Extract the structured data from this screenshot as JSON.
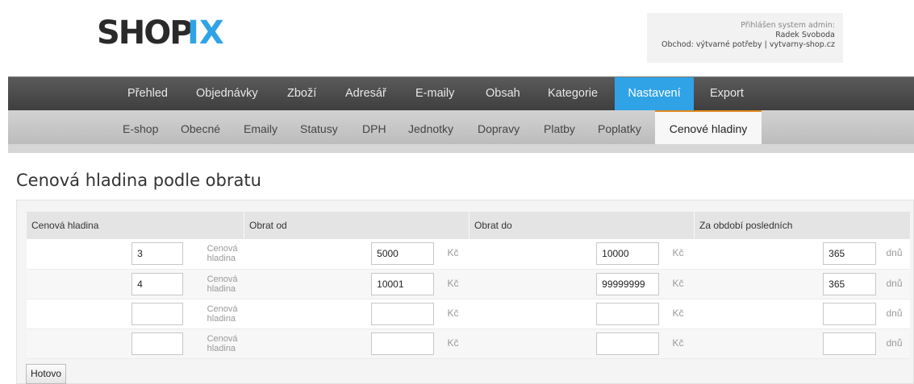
{
  "brand": {
    "logo_text": "SHOPIX",
    "accent_color": "#2fa3e6",
    "logo_color": "#2a2a2a",
    "logo_dot_color": "#2fa3e6"
  },
  "user": {
    "logged_in_label": "Přihlášen system admin:",
    "name": "Radek Svoboda",
    "shop_line": "Obchod: výtvarné potřeby | vytvarny-shop.cz"
  },
  "main_nav": {
    "items": [
      {
        "label": "Přehled"
      },
      {
        "label": "Objednávky"
      },
      {
        "label": "Zboží"
      },
      {
        "label": "Adresář"
      },
      {
        "label": "E-maily"
      },
      {
        "label": "Obsah"
      },
      {
        "label": "Kategorie"
      },
      {
        "label": "Nastavení",
        "active": true
      },
      {
        "label": "Export"
      }
    ]
  },
  "sub_nav": {
    "items": [
      {
        "label": "E-shop"
      },
      {
        "label": "Obecné"
      },
      {
        "label": "Emaily"
      },
      {
        "label": "Statusy"
      },
      {
        "label": "DPH"
      },
      {
        "label": "Jednotky"
      },
      {
        "label": "Dopravy"
      },
      {
        "label": "Platby"
      },
      {
        "label": "Poplatky"
      },
      {
        "label": "Cenové hladiny",
        "active": true
      }
    ]
  },
  "page": {
    "title": "Cenová hladina podle obratu"
  },
  "table": {
    "columns": [
      "Cenová hladina",
      "Obrat od",
      "Obrat do",
      "Za období posledních"
    ],
    "unit_level_line1": "Cenová",
    "unit_level_line2": "hladina",
    "unit_currency": "Kč",
    "unit_days": "dnů",
    "rows": [
      {
        "level": "3",
        "from": "5000",
        "to": "10000",
        "days": "365"
      },
      {
        "level": "4",
        "from": "10001",
        "to": "99999999",
        "days": "365"
      },
      {
        "level": "",
        "from": "",
        "to": "",
        "days": ""
      },
      {
        "level": "",
        "from": "",
        "to": "",
        "days": ""
      }
    ]
  },
  "actions": {
    "submit_label": "Hotovo"
  }
}
